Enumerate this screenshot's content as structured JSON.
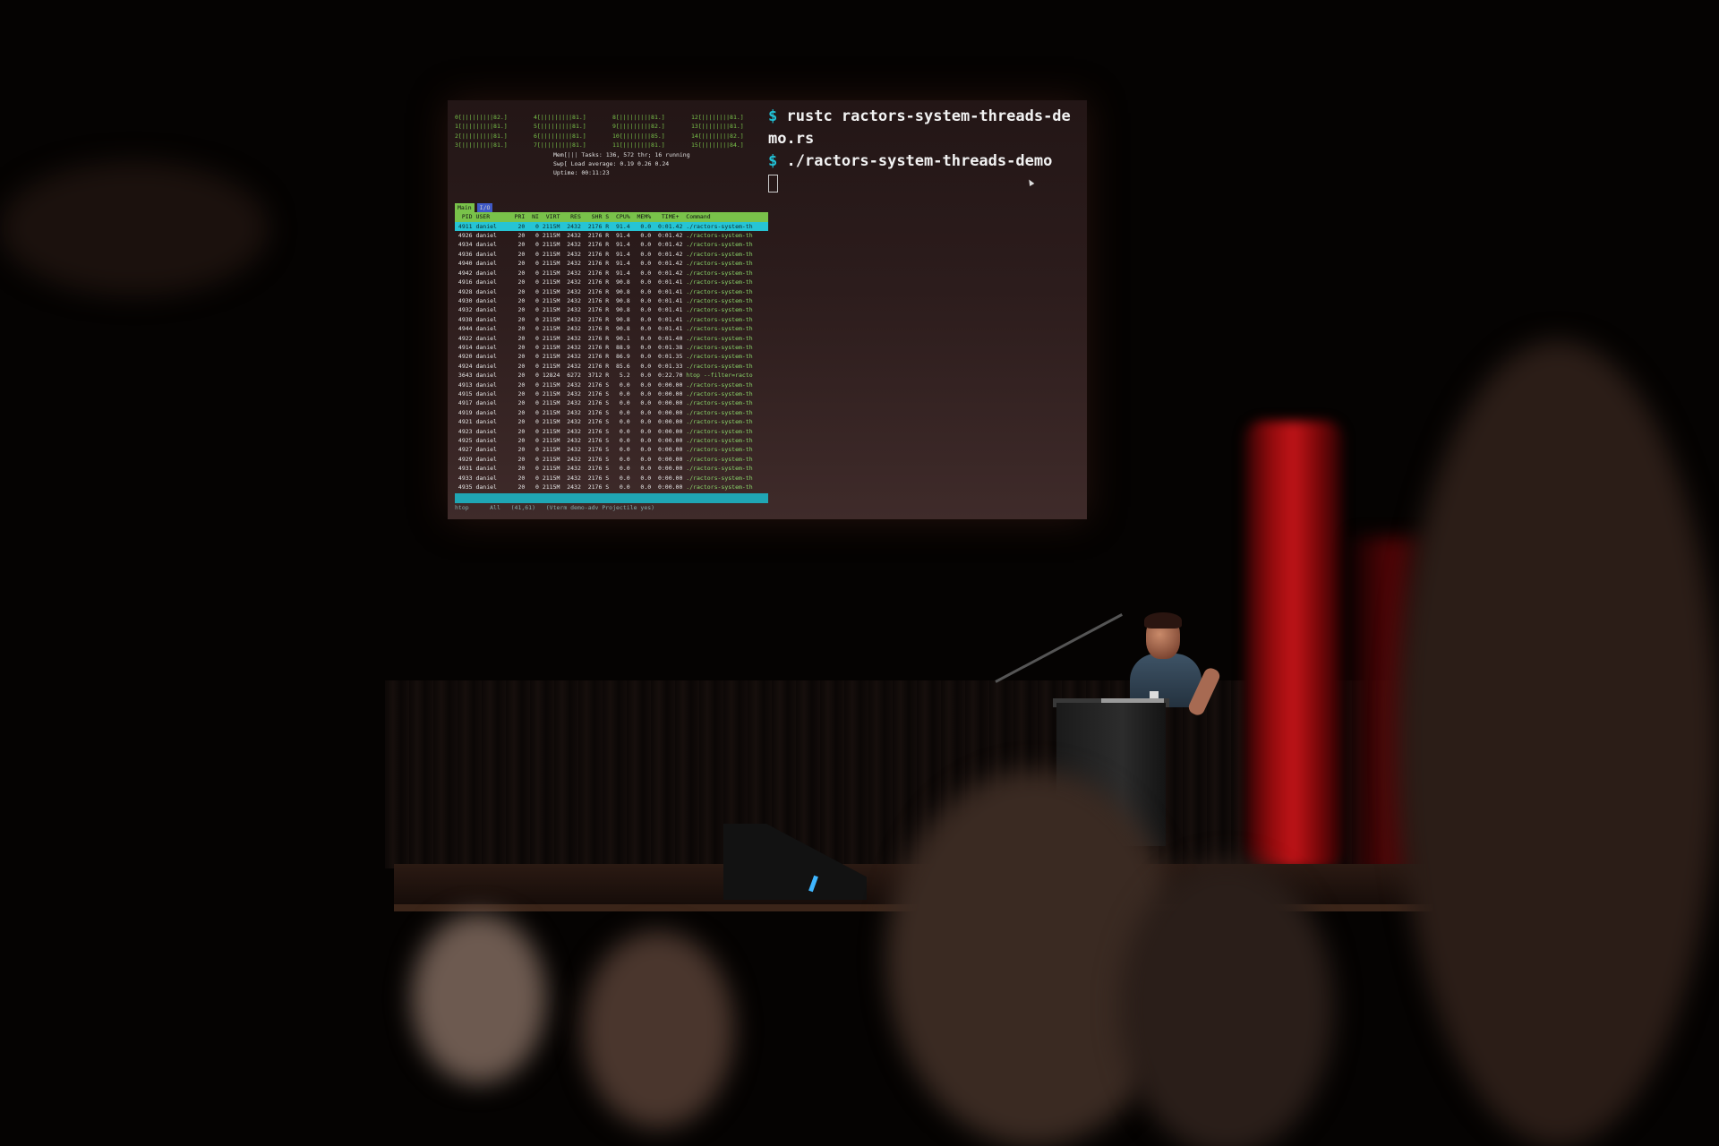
{
  "htop": {
    "meters": [
      "0[|||||||||82.]",
      "4[|||||||||81.]",
      "8[|||||||||81.]",
      "12[||||||||81.]",
      "1[|||||||||81.]",
      "5[|||||||||81.]",
      "9[|||||||||82.]",
      "13[||||||||81.]",
      "2[|||||||||81.]",
      "6[|||||||||81.]",
      "10[||||||||85.]",
      "14[||||||||82.]",
      "3[|||||||||81.]",
      "7[|||||||||81.]",
      "11[||||||||81.]",
      "15[||||||||84.]"
    ],
    "mem_label": "Mem[",
    "swp_label": "Swp[",
    "tasks_label": "Tasks:",
    "tasks_value": "136, 572 thr; 16 running",
    "load_label": "Load average:",
    "load_value": "0.19 0.26 0.24",
    "uptime_label": "Uptime:",
    "uptime_value": "00:11:23",
    "tabs": [
      "Main",
      "I/O"
    ],
    "header": "  PID USER       PRI  NI  VIRT   RES   SHR S  CPU%  MEM%   TIME+  Command",
    "selected_row": " 4911 daniel      20   0 2115M  2432  2176 R  91.4   0.0  0:01.42 ./ractors-system-th",
    "rows": [
      {
        "line": " 4926 daniel      20   0 2115M  2432  2176 R  91.4   0.0  0:01.42 ",
        "cmd": "./ractors-system-th"
      },
      {
        "line": " 4934 daniel      20   0 2115M  2432  2176 R  91.4   0.0  0:01.42 ",
        "cmd": "./ractors-system-th"
      },
      {
        "line": " 4936 daniel      20   0 2115M  2432  2176 R  91.4   0.0  0:01.42 ",
        "cmd": "./ractors-system-th"
      },
      {
        "line": " 4940 daniel      20   0 2115M  2432  2176 R  91.4   0.0  0:01.42 ",
        "cmd": "./ractors-system-th"
      },
      {
        "line": " 4942 daniel      20   0 2115M  2432  2176 R  91.4   0.0  0:01.42 ",
        "cmd": "./ractors-system-th"
      },
      {
        "line": " 4916 daniel      20   0 2115M  2432  2176 R  90.8   0.0  0:01.41 ",
        "cmd": "./ractors-system-th"
      },
      {
        "line": " 4928 daniel      20   0 2115M  2432  2176 R  90.8   0.0  0:01.41 ",
        "cmd": "./ractors-system-th"
      },
      {
        "line": " 4930 daniel      20   0 2115M  2432  2176 R  90.8   0.0  0:01.41 ",
        "cmd": "./ractors-system-th"
      },
      {
        "line": " 4932 daniel      20   0 2115M  2432  2176 R  90.8   0.0  0:01.41 ",
        "cmd": "./ractors-system-th"
      },
      {
        "line": " 4938 daniel      20   0 2115M  2432  2176 R  90.8   0.0  0:01.41 ",
        "cmd": "./ractors-system-th"
      },
      {
        "line": " 4944 daniel      20   0 2115M  2432  2176 R  90.8   0.0  0:01.41 ",
        "cmd": "./ractors-system-th"
      },
      {
        "line": " 4922 daniel      20   0 2115M  2432  2176 R  90.1   0.0  0:01.40 ",
        "cmd": "./ractors-system-th"
      },
      {
        "line": " 4914 daniel      20   0 2115M  2432  2176 R  88.9   0.0  0:01.38 ",
        "cmd": "./ractors-system-th"
      },
      {
        "line": " 4920 daniel      20   0 2115M  2432  2176 R  86.9   0.0  0:01.35 ",
        "cmd": "./ractors-system-th"
      },
      {
        "line": " 4924 daniel      20   0 2115M  2432  2176 R  85.6   0.0  0:01.33 ",
        "cmd": "./ractors-system-th"
      },
      {
        "line": " 3643 daniel      20   0 12824  6272  3712 R   5.2   0.0  0:22.70 ",
        "cmd": "htop --filter=racto"
      },
      {
        "line": " 4913 daniel      20   0 2115M  2432  2176 S   0.0   0.0  0:00.00 ",
        "cmd": "./ractors-system-th"
      },
      {
        "line": " 4915 daniel      20   0 2115M  2432  2176 S   0.0   0.0  0:00.00 ",
        "cmd": "./ractors-system-th"
      },
      {
        "line": " 4917 daniel      20   0 2115M  2432  2176 S   0.0   0.0  0:00.00 ",
        "cmd": "./ractors-system-th"
      },
      {
        "line": " 4919 daniel      20   0 2115M  2432  2176 S   0.0   0.0  0:00.00 ",
        "cmd": "./ractors-system-th"
      },
      {
        "line": " 4921 daniel      20   0 2115M  2432  2176 S   0.0   0.0  0:00.00 ",
        "cmd": "./ractors-system-th"
      },
      {
        "line": " 4923 daniel      20   0 2115M  2432  2176 S   0.0   0.0  0:00.00 ",
        "cmd": "./ractors-system-th"
      },
      {
        "line": " 4925 daniel      20   0 2115M  2432  2176 S   0.0   0.0  0:00.00 ",
        "cmd": "./ractors-system-th"
      },
      {
        "line": " 4927 daniel      20   0 2115M  2432  2176 S   0.0   0.0  0:00.00 ",
        "cmd": "./ractors-system-th"
      },
      {
        "line": " 4929 daniel      20   0 2115M  2432  2176 S   0.0   0.0  0:00.00 ",
        "cmd": "./ractors-system-th"
      },
      {
        "line": " 4931 daniel      20   0 2115M  2432  2176 S   0.0   0.0  0:00.00 ",
        "cmd": "./ractors-system-th"
      },
      {
        "line": " 4933 daniel      20   0 2115M  2432  2176 S   0.0   0.0  0:00.00 ",
        "cmd": "./ractors-system-th"
      },
      {
        "line": " 4935 daniel      20   0 2115M  2432  2176 S   0.0   0.0  0:00.00 ",
        "cmd": "./ractors-system-th"
      }
    ],
    "statusbar": "htop      All   (41,61)   (Vterm demo-adv Projectile yes)"
  },
  "terminal": {
    "prompt": "$",
    "line1": "rustc ractors-system-threads-de",
    "line2": "mo.rs",
    "line3": "./ractors-system-threads-demo"
  },
  "colors": {
    "htop_green": "#79c24a",
    "htop_cyan": "#26c4d4",
    "prompt_cyan": "#21c1d6",
    "curtain_red": "#c11418"
  }
}
